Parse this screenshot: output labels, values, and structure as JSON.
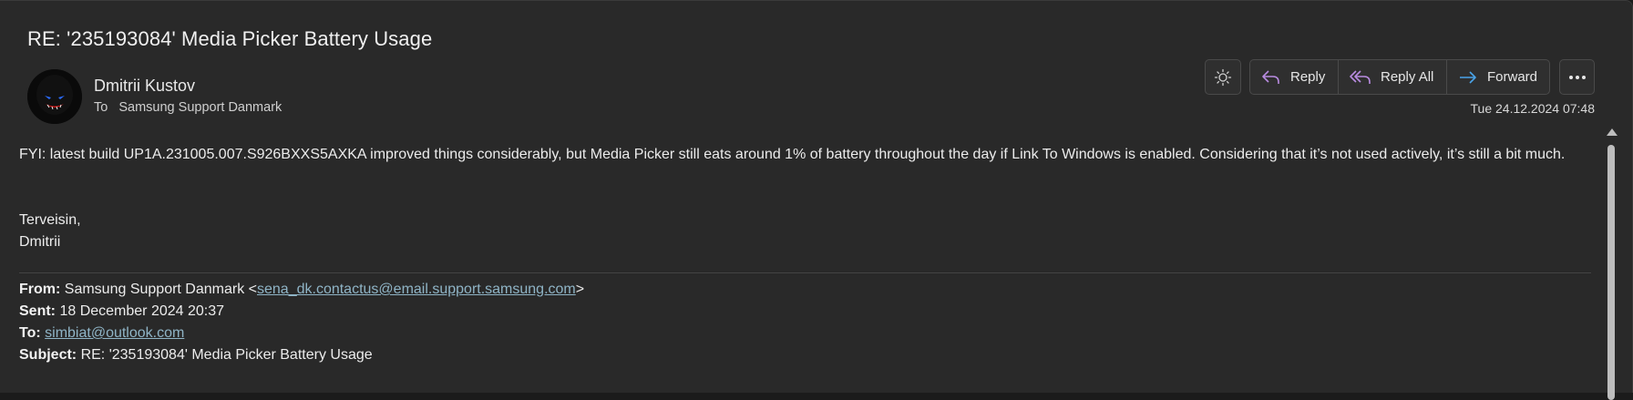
{
  "email": {
    "subject": "RE: '235193084' Media Picker Battery Usage",
    "sender_name": "Dmitrii Kustov",
    "to_label": "To",
    "to_value": "Samsung Support Danmark",
    "date": "Tue 24.12.2024 07:48"
  },
  "toolbar": {
    "reply_label": "Reply",
    "reply_all_label": "Reply All",
    "forward_label": "Forward",
    "accent": "#a78bda"
  },
  "body": {
    "paragraph": "FYI: latest build UP1A.231005.007.S926BXXS5AXKA improved things considerably, but Media Picker still eats around 1% of battery throughout the day if Link To Windows is enabled. Considering that it’s not used actively, it’s still a bit much.",
    "greeting": "Terveisin,",
    "signature_name": "Dmitrii"
  },
  "quoted": {
    "from_label": "From:",
    "from_name": "Samsung Support Danmark <",
    "from_email": "sena_dk.contactus@email.support.samsung.com",
    "from_close": ">",
    "sent_label": "Sent:",
    "sent_value": "18 December 2024 20:37",
    "to_label": "To:",
    "to_email": "simbiat@outlook.com",
    "subject_label": "Subject:",
    "subject_value": "RE: '235193084' Media Picker Battery Usage"
  }
}
